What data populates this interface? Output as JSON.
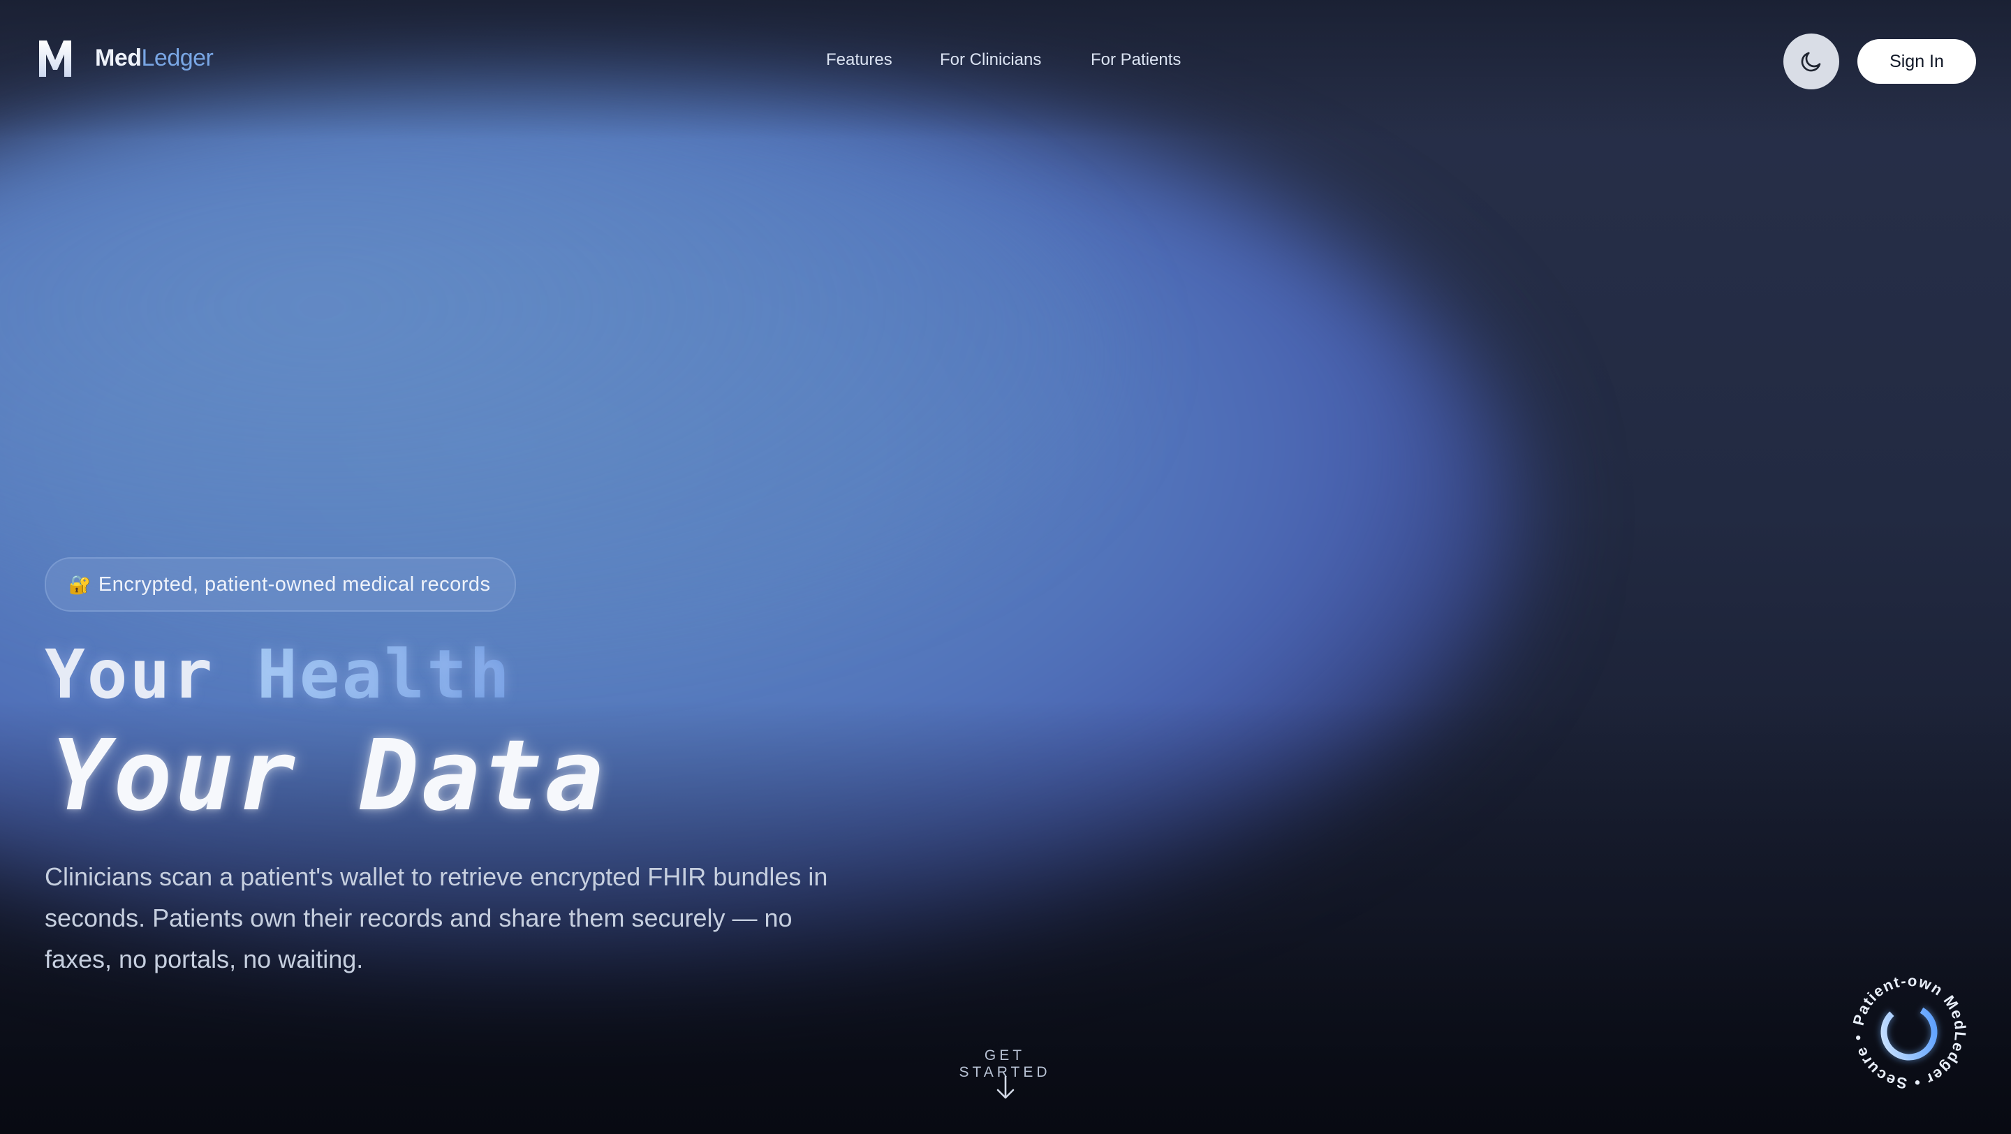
{
  "brand": {
    "logo_letter": "M",
    "name_part1": "Med",
    "name_part2": "Ledger"
  },
  "nav": {
    "items": [
      {
        "label": "Features"
      },
      {
        "label": "For Clinicians"
      },
      {
        "label": "For Patients"
      }
    ]
  },
  "header": {
    "theme_toggle_icon": "moon-icon",
    "sign_in_label": "Sign In"
  },
  "hero": {
    "badge_icon": "🔐",
    "badge_text": "Encrypted, patient-owned medical records",
    "title_line1_part1": "Your ",
    "title_line1_part2": "Health",
    "title_line2": "Your Data",
    "description": "Clinicians scan a patient's wallet to retrieve encrypted FHIR bundles in seconds. Patients own their records and share them securely — no faxes, no portals, no waiting."
  },
  "cta": {
    "get_started_label": "GET STARTED",
    "arrow_icon": "arrow-down-icon"
  },
  "circle_badge": {
    "text": "Patient-own MedLedger • Secure •"
  },
  "colors": {
    "accent": "#79a6e4",
    "background": "#1a2033",
    "glow": "#5a80c0"
  }
}
